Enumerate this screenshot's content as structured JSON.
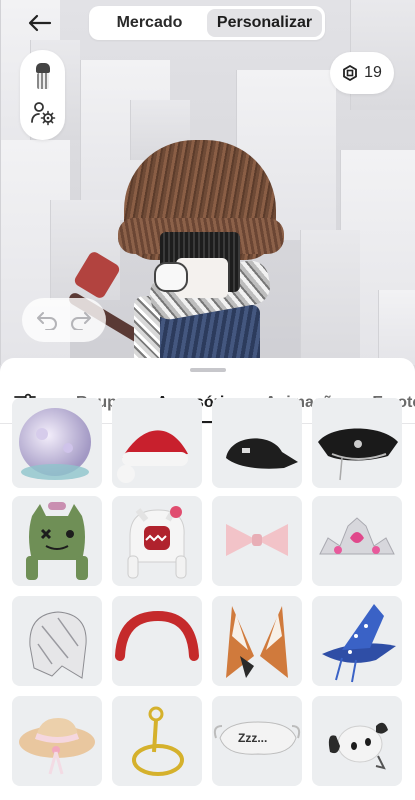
{
  "header": {
    "segments": [
      {
        "label": "Mercado",
        "active": false
      },
      {
        "label": "Personalizar",
        "active": true
      }
    ]
  },
  "robux": {
    "balance": "19",
    "icon": "robux-icon"
  },
  "tabs": [
    {
      "label": "Roupas",
      "active": false
    },
    {
      "label": "Acessórios",
      "active": true
    },
    {
      "label": "Animações",
      "active": false
    },
    {
      "label": "Emote",
      "active": false
    }
  ],
  "items": [
    {
      "icon": "bubble-helmet-icon"
    },
    {
      "icon": "santa-hat-icon"
    },
    {
      "icon": "black-cap-icon"
    },
    {
      "icon": "police-hat-icon"
    },
    {
      "icon": "green-monster-hat-icon"
    },
    {
      "icon": "white-plush-hat-icon"
    },
    {
      "icon": "pink-bow-icon"
    },
    {
      "icon": "tiara-icon"
    },
    {
      "icon": "silver-hood-icon"
    },
    {
      "icon": "red-headband-icon"
    },
    {
      "icon": "fox-ears-icon"
    },
    {
      "icon": "wizard-hat-icon"
    },
    {
      "icon": "straw-hat-icon"
    },
    {
      "icon": "gold-halo-icon"
    },
    {
      "icon": "sleep-mask-icon"
    },
    {
      "icon": "dog-plush-icon"
    }
  ],
  "sleep_mask_text": "Zzz...",
  "colors": {
    "accent": "#1d1d1d",
    "sheet": "#ffffff",
    "tile": "#eceef0"
  }
}
